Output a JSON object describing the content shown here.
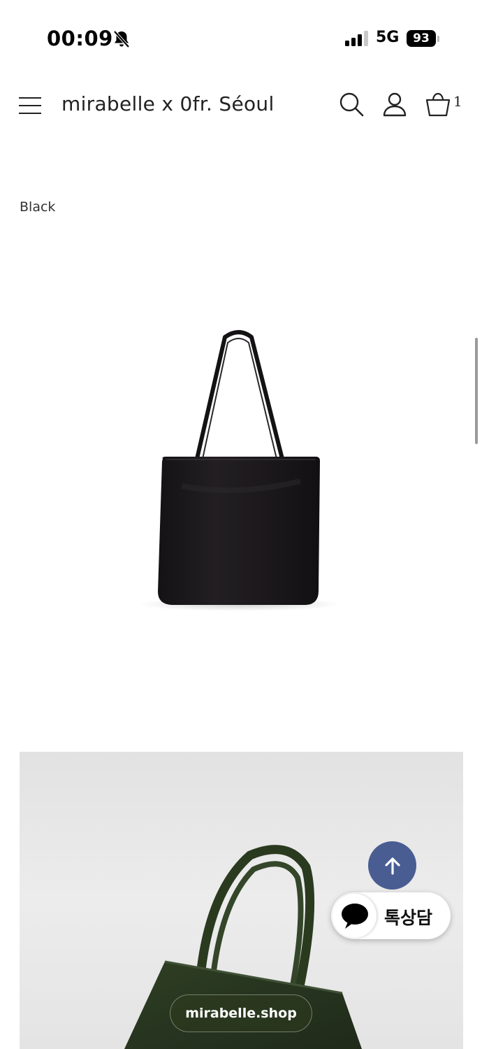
{
  "status_bar": {
    "time": "00:09",
    "network": "5G",
    "battery": "93"
  },
  "header": {
    "brand": "mirabelle x 0fr. Séoul",
    "cart_count": "1",
    "icons": [
      "menu-icon",
      "search-icon",
      "user-icon",
      "cart-icon"
    ]
  },
  "product": {
    "color_label": "Black"
  },
  "floating": {
    "chat_label": "톡상담",
    "shop_badge": "mirabelle.shop"
  },
  "colors": {
    "scroll_top_bg": "#4a5d92",
    "bag_black": "#1a1719",
    "bag_green": "#2a3a1f"
  }
}
